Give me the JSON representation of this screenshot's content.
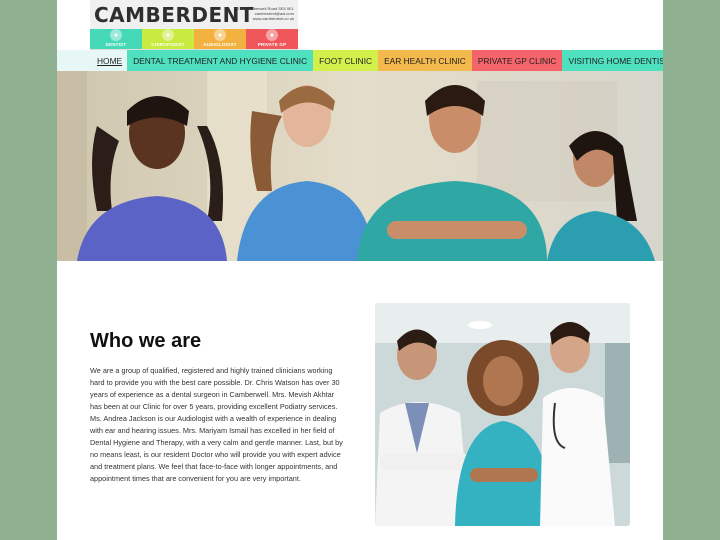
{
  "logo": {
    "title": "CAMBERDENT",
    "address": [
      "27A Camberwell Road SE5 0EL",
      "camberdent@aol.com",
      "www.camberdent.co.uk"
    ],
    "tabs": [
      {
        "label": "DENTIST",
        "color": "#46d9b7",
        "icon": "tooth-icon"
      },
      {
        "label": "CHIROPODIST",
        "color": "#c9ea3e",
        "icon": "foot-icon"
      },
      {
        "label": "AUDIOLOGIST",
        "color": "#f3b23f",
        "icon": "ear-icon"
      },
      {
        "label": "PRIVATE GP",
        "color": "#f0575a",
        "icon": "stethoscope-icon"
      }
    ]
  },
  "nav": {
    "items": [
      {
        "label": "HOME",
        "color": "transparent"
      },
      {
        "label": "DENTAL TREATMENT AND HYGIENE CLINIC",
        "color": "#4fe0c0"
      },
      {
        "label": "FOOT CLINIC",
        "color": "#d3f04a"
      },
      {
        "label": "EAR HEALTH CLINIC",
        "color": "#f4b94c"
      },
      {
        "label": "PRIVATE GP CLINIC",
        "color": "#f5646a"
      },
      {
        "label": "VISITING HOME DENTIST",
        "color": "#4fe0c0"
      }
    ]
  },
  "about": {
    "heading": "Who we are",
    "body": "We are a group of qualified, registered and highly trained clinicians working hard to provide you with the best care possible. Dr. Chris Watson has over 30 years of experience as a dental surgeon in Camberwell. Mrs. Mevish Akhtar has been at our Clinic for over 5 years, providing excellent Podiatry services. Ms. Andrea Jackson is our Audiologist with a wealth of experience in dealing with ear and hearing issues. Mrs. Mariyam Ismail has excelled in her field of Dental Hygiene and Therapy, with a very calm and gentle manner. Last, but by no means least, is our resident Doctor who will provide you with expert advice and treatment plans. We feel that face-to-face with longer appointments, and appointment times that are convenient for you are very important."
  }
}
